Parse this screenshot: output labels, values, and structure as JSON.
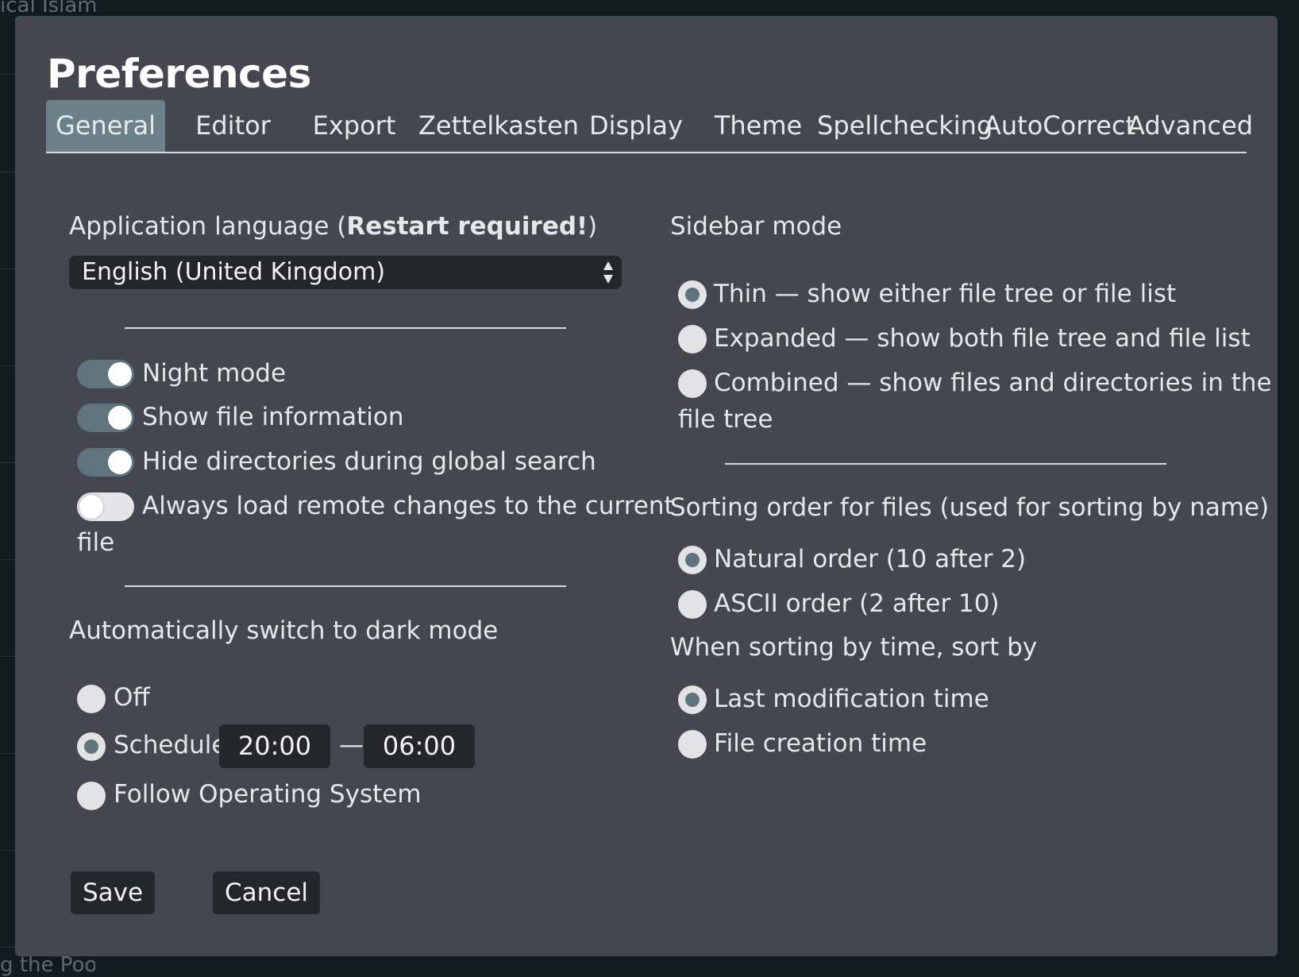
{
  "background": {
    "fragments": [
      "ical Islami",
      "g the Poo"
    ]
  },
  "dialog": {
    "title": "Preferences",
    "tabs": [
      {
        "label": "General",
        "active": true
      },
      {
        "label": "Editor"
      },
      {
        "label": "Export"
      },
      {
        "label": "Zettelkasten"
      },
      {
        "label": "Display"
      },
      {
        "label": "Theme"
      },
      {
        "label": "Spellchecking"
      },
      {
        "label": "AutoCorrect"
      },
      {
        "label": "Advanced"
      }
    ]
  },
  "general": {
    "language_label": "Application language (",
    "language_required": "Restart required!",
    "language_label_end": ")",
    "language_value": "English (United Kingdom)",
    "toggles": [
      {
        "label": "Night mode",
        "on": true
      },
      {
        "label": "Show file information",
        "on": true
      },
      {
        "label": "Hide directories during global search",
        "on": true
      },
      {
        "label": "Always load remote changes to the current",
        "label_cont": "file",
        "on": false
      }
    ],
    "dark_mode": {
      "heading": "Automatically switch to dark mode",
      "options": [
        "Off",
        "Schedule",
        "Follow Operating System"
      ],
      "selected": "Schedule",
      "start": "20:00",
      "separator": "—",
      "end": "06:00"
    },
    "sidebar": {
      "heading": "Sidebar mode",
      "options": [
        "Thin — show either file tree or file list",
        "Expanded — show both file tree and file list",
        "Combined — show files and directories in the"
      ],
      "option3_cont": "file tree",
      "selected": 0
    },
    "sorting": {
      "heading": "Sorting order for files (used for sorting by name)",
      "options": [
        "Natural order (10 after 2)",
        "ASCII order (2 after 10)"
      ],
      "selected": 0
    },
    "time_sort": {
      "heading": "When sorting by time, sort by",
      "options": [
        "Last modification time",
        "File creation time"
      ],
      "selected": 0
    }
  },
  "buttons": {
    "save": "Save",
    "cancel": "Cancel"
  },
  "colors": {
    "modal_bg": "#45464f",
    "accent": "#6c8089",
    "input_bg": "#25262b"
  }
}
